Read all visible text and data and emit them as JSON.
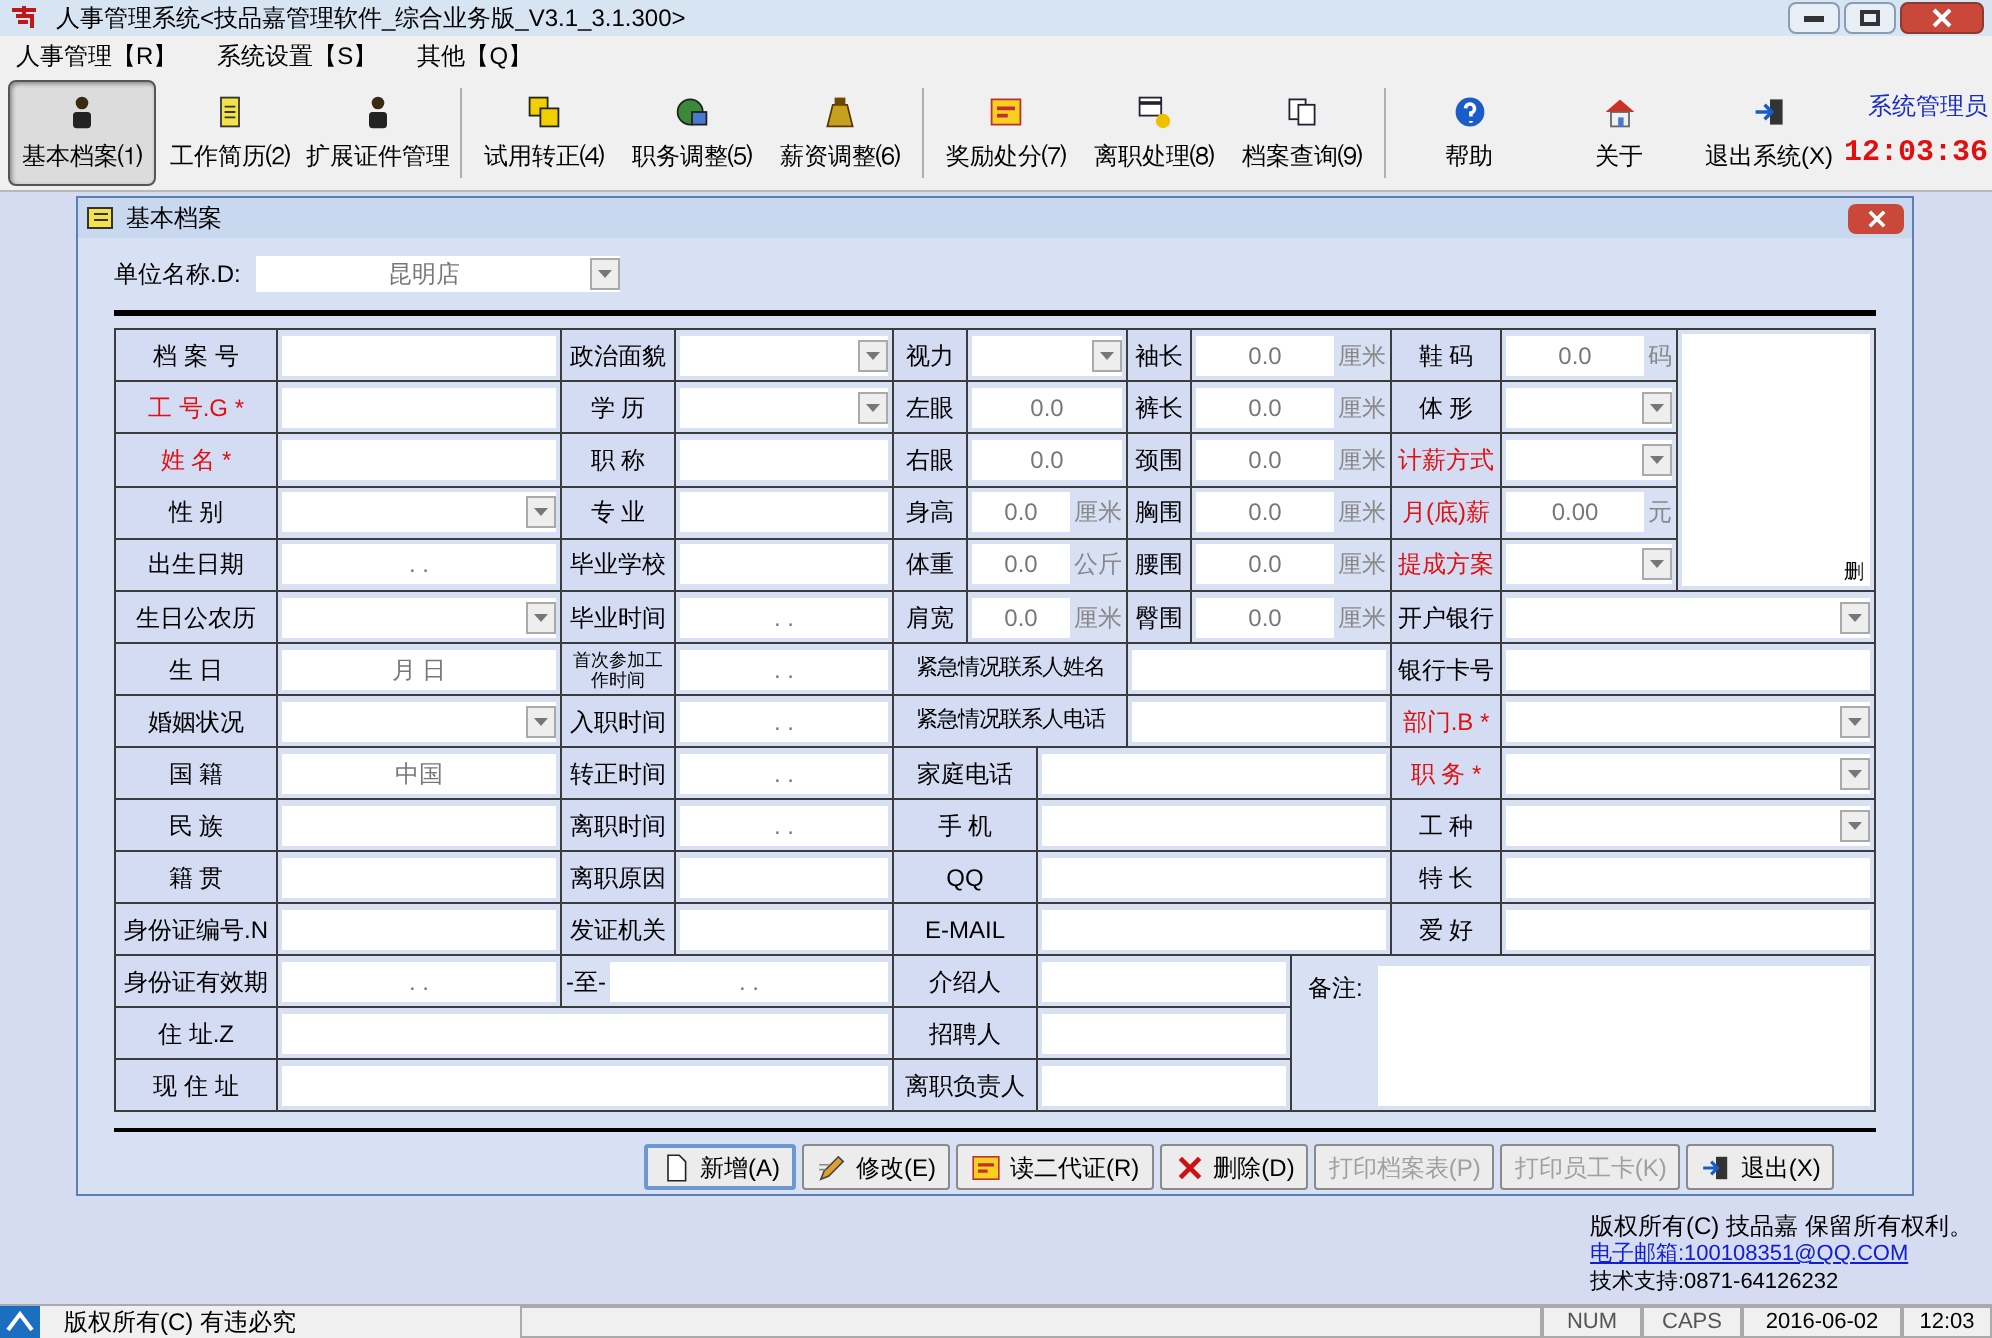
{
  "window": {
    "title": "人事管理系统<技品嘉管理软件_综合业务版_V3.1_3.1.300>"
  },
  "menu": [
    "人事管理【R】",
    "系统设置【S】",
    "其他【Q】"
  ],
  "toolbar": [
    {
      "label": "基本档案⑴",
      "selected": true
    },
    {
      "label": "工作简历⑵",
      "selected": false
    },
    {
      "label": "扩展证件管理",
      "selected": false
    },
    {
      "label": "试用转正⑷",
      "selected": false
    },
    {
      "label": "职务调整⑸",
      "selected": false
    },
    {
      "label": "薪资调整⑹",
      "selected": false
    },
    {
      "label": "奖励处分⑺",
      "selected": false
    },
    {
      "label": "离职处理⑻",
      "selected": false
    },
    {
      "label": "档案查询⑼",
      "selected": false
    },
    {
      "label": "帮助",
      "selected": false
    },
    {
      "label": "关于",
      "selected": false
    },
    {
      "label": "退出系统(X)",
      "selected": false
    }
  ],
  "user": "系统管理员",
  "clock": "12:03:36",
  "dialog": {
    "title": "基本档案",
    "unit": {
      "label": "单位名称.D:",
      "value": "昆明店"
    },
    "rows": [
      [
        {
          "kind": "label",
          "text": "档 案 号"
        },
        {
          "kind": "input"
        },
        {
          "kind": "label",
          "text": "政治面貌"
        },
        {
          "kind": "select"
        },
        {
          "kind": "label",
          "text": "视力"
        },
        {
          "kind": "select",
          "colspan": 2
        },
        {
          "kind": "label",
          "text": "袖长"
        },
        {
          "kind": "input",
          "value": "0.0",
          "unit": "厘米",
          "colspan": 2
        },
        {
          "kind": "label",
          "text": "鞋 码"
        },
        {
          "kind": "input",
          "value": "0.0",
          "unit": "码"
        }
      ],
      [
        {
          "kind": "label",
          "text": "工 号.G *",
          "required": true
        },
        {
          "kind": "input"
        },
        {
          "kind": "label",
          "text": "学 历"
        },
        {
          "kind": "select"
        },
        {
          "kind": "label",
          "text": "左眼"
        },
        {
          "kind": "input",
          "value": "0.0",
          "colspan": 2
        },
        {
          "kind": "label",
          "text": "裤长"
        },
        {
          "kind": "input",
          "value": "0.0",
          "unit": "厘米",
          "colspan": 2
        },
        {
          "kind": "label",
          "text": "体 形"
        },
        {
          "kind": "select"
        }
      ],
      [
        {
          "kind": "label",
          "text": "姓 名 *",
          "required": true
        },
        {
          "kind": "input"
        },
        {
          "kind": "label",
          "text": "职 称"
        },
        {
          "kind": "input"
        },
        {
          "kind": "label",
          "text": "右眼"
        },
        {
          "kind": "input",
          "value": "0.0",
          "colspan": 2
        },
        {
          "kind": "label",
          "text": "颈围"
        },
        {
          "kind": "input",
          "value": "0.0",
          "unit": "厘米",
          "colspan": 2
        },
        {
          "kind": "label",
          "text": "计薪方式",
          "required": true
        },
        {
          "kind": "select"
        }
      ],
      [
        {
          "kind": "label",
          "text": "性 别"
        },
        {
          "kind": "select"
        },
        {
          "kind": "label",
          "text": "专 业"
        },
        {
          "kind": "input"
        },
        {
          "kind": "label",
          "text": "身高"
        },
        {
          "kind": "input",
          "value": "0.0",
          "unit": "厘米",
          "colspan": 2
        },
        {
          "kind": "label",
          "text": "胸围"
        },
        {
          "kind": "input",
          "value": "0.0",
          "unit": "厘米",
          "colspan": 2
        },
        {
          "kind": "label",
          "text": "月(底)薪",
          "required": true
        },
        {
          "kind": "input",
          "value": "0.00",
          "unit": "元"
        }
      ],
      [
        {
          "kind": "label",
          "text": "出生日期"
        },
        {
          "kind": "input",
          "value": ". ."
        },
        {
          "kind": "label",
          "text": "毕业学校"
        },
        {
          "kind": "input"
        },
        {
          "kind": "label",
          "text": "体重"
        },
        {
          "kind": "input",
          "value": "0.0",
          "unit": "公斤",
          "colspan": 2
        },
        {
          "kind": "label",
          "text": "腰围"
        },
        {
          "kind": "input",
          "value": "0.0",
          "unit": "厘米",
          "colspan": 2
        },
        {
          "kind": "label",
          "text": "提成方案",
          "required": true
        },
        {
          "kind": "select"
        }
      ],
      [
        {
          "kind": "label",
          "text": "生日公农历"
        },
        {
          "kind": "select"
        },
        {
          "kind": "label",
          "text": "毕业时间"
        },
        {
          "kind": "input",
          "value": ". ."
        },
        {
          "kind": "label",
          "text": "肩宽"
        },
        {
          "kind": "input",
          "value": "0.0",
          "unit": "厘米",
          "colspan": 2
        },
        {
          "kind": "label",
          "text": "臀围"
        },
        {
          "kind": "input",
          "value": "0.0",
          "unit": "厘米",
          "colspan": 2
        },
        {
          "kind": "label",
          "text": "开户银行"
        },
        {
          "kind": "select",
          "colspan": 2
        }
      ],
      [
        {
          "kind": "label",
          "text": "生 日"
        },
        {
          "kind": "input",
          "value": "月 日"
        },
        {
          "kind": "label",
          "text": "首次参加工作时间"
        },
        {
          "kind": "input",
          "value": ". ."
        },
        {
          "kind": "label",
          "text": "紧急情况联系人姓名",
          "colspan": 3
        },
        {
          "kind": "input",
          "colspan": 3
        },
        {
          "kind": "label",
          "text": "银行卡号"
        },
        {
          "kind": "input",
          "colspan": 2
        }
      ],
      [
        {
          "kind": "label",
          "text": "婚姻状况"
        },
        {
          "kind": "select"
        },
        {
          "kind": "label",
          "text": "入职时间"
        },
        {
          "kind": "input",
          "value": ". ."
        },
        {
          "kind": "label",
          "text": "紧急情况联系人电话",
          "colspan": 3
        },
        {
          "kind": "input",
          "colspan": 3
        },
        {
          "kind": "label",
          "text": "部门.B *",
          "required": true
        },
        {
          "kind": "select",
          "colspan": 2
        }
      ],
      [
        {
          "kind": "label",
          "text": "国 籍"
        },
        {
          "kind": "input",
          "value": "中国"
        },
        {
          "kind": "label",
          "text": "转正时间"
        },
        {
          "kind": "input",
          "value": ". ."
        },
        {
          "kind": "label",
          "text": "家庭电话",
          "colspan": 2
        },
        {
          "kind": "input",
          "colspan": 4
        },
        {
          "kind": "label",
          "text": "职 务 *",
          "required": true
        },
        {
          "kind": "select",
          "colspan": 2
        }
      ],
      [
        {
          "kind": "label",
          "text": "民 族"
        },
        {
          "kind": "input"
        },
        {
          "kind": "label",
          "text": "离职时间"
        },
        {
          "kind": "input",
          "value": ". ."
        },
        {
          "kind": "label",
          "text": "手 机",
          "colspan": 2
        },
        {
          "kind": "input",
          "colspan": 4
        },
        {
          "kind": "label",
          "text": "工 种"
        },
        {
          "kind": "select",
          "colspan": 2
        }
      ],
      [
        {
          "kind": "label",
          "text": "籍 贯"
        },
        {
          "kind": "input"
        },
        {
          "kind": "label",
          "text": "离职原因"
        },
        {
          "kind": "input"
        },
        {
          "kind": "label",
          "text": "QQ",
          "colspan": 2
        },
        {
          "kind": "input",
          "colspan": 4
        },
        {
          "kind": "label",
          "text": "特 长"
        },
        {
          "kind": "input",
          "colspan": 2
        }
      ],
      [
        {
          "kind": "label",
          "text": "身份证编号.N"
        },
        {
          "kind": "input"
        },
        {
          "kind": "label",
          "text": "发证机关"
        },
        {
          "kind": "input"
        },
        {
          "kind": "label",
          "text": "E-MAIL",
          "colspan": 2
        },
        {
          "kind": "input",
          "colspan": 4
        },
        {
          "kind": "label",
          "text": "爱 好"
        },
        {
          "kind": "input",
          "colspan": 2
        }
      ],
      [
        {
          "kind": "label",
          "text": "身份证有效期"
        },
        {
          "kind": "input",
          "value": ". ."
        },
        {
          "kind": "input",
          "prefix": "-至-",
          "value": ". .",
          "colspan": 2
        },
        {
          "kind": "label",
          "text": "介绍人",
          "colspan": 2
        },
        {
          "kind": "input",
          "colspan": 3
        }
      ],
      [
        {
          "kind": "label",
          "text": "住 址.Z"
        },
        {
          "kind": "input",
          "colspan": 3
        },
        {
          "kind": "label",
          "text": "招聘人",
          "colspan": 2
        },
        {
          "kind": "input",
          "colspan": 3
        }
      ],
      [
        {
          "kind": "label",
          "text": "现 住 址"
        },
        {
          "kind": "input",
          "colspan": 3
        },
        {
          "kind": "label",
          "text": "离职负责人",
          "colspan": 2
        },
        {
          "kind": "input",
          "colspan": 3
        }
      ]
    ],
    "photo": {
      "action": "删"
    },
    "memo": {
      "label": "备注:"
    },
    "buttons": [
      {
        "label": "新增(A)",
        "disabled": false,
        "focused": true
      },
      {
        "label": "修改(E)",
        "disabled": false,
        "focused": false
      },
      {
        "label": "读二代证(R)",
        "disabled": false,
        "focused": false
      },
      {
        "label": "删除(D)",
        "disabled": false,
        "focused": false
      },
      {
        "label": "打印档案表(P)",
        "disabled": true,
        "focused": false
      },
      {
        "label": "打印员工卡(K)",
        "disabled": true,
        "focused": false
      },
      {
        "label": "退出(X)",
        "disabled": false,
        "focused": false
      }
    ]
  },
  "copyright": {
    "notice": "版权所有(C) 技品嘉 保留所有权利。",
    "email": "电子邮箱:100108351@QQ.COM",
    "support": "技术支持:0871-64126232"
  },
  "status_bar": {
    "text": "版权所有(C) 有违必究",
    "panels": [
      "NUM",
      "CAPS",
      "2016-06-02",
      "12:03"
    ]
  }
}
